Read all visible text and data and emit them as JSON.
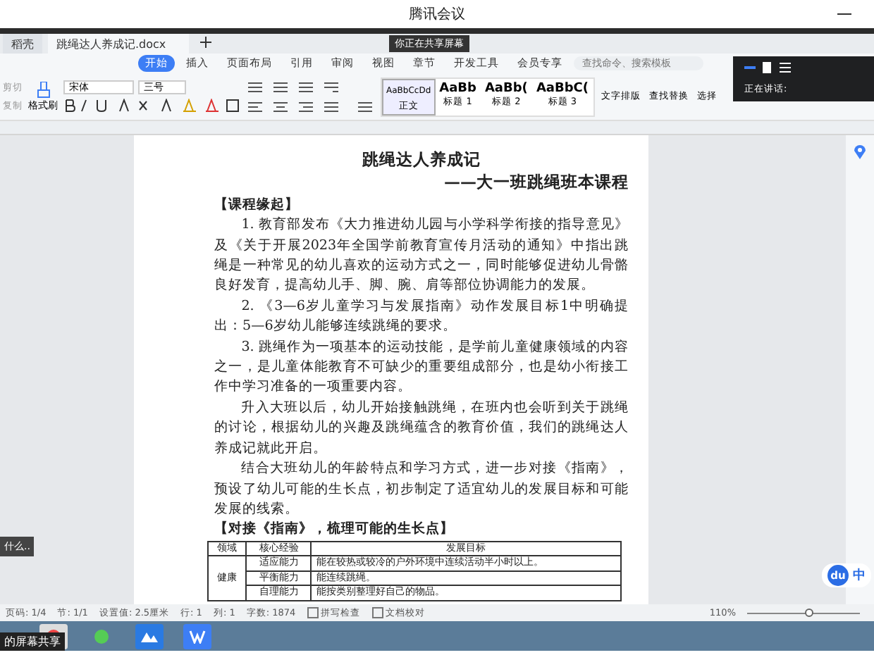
{
  "window": {
    "title": "腾讯会议"
  },
  "share_badge": "你正在共享屏幕",
  "tabs": [
    {
      "label": "稻壳",
      "selected": false
    },
    {
      "label": "跳绳达人养成记.docx",
      "selected": true
    }
  ],
  "menu": [
    {
      "label": "开始",
      "selected": true
    },
    {
      "label": "插入",
      "selected": false
    },
    {
      "label": "页面布局",
      "selected": false
    },
    {
      "label": "引用",
      "selected": false
    },
    {
      "label": "审阅",
      "selected": false
    },
    {
      "label": "视图",
      "selected": false
    },
    {
      "label": "章节",
      "selected": false
    },
    {
      "label": "开发工具",
      "selected": false
    },
    {
      "label": "会员专享",
      "selected": false
    }
  ],
  "search": {
    "placeholder": "查找命令、搜索模板"
  },
  "toolbar": {
    "clip": [
      "剪切",
      "复制"
    ],
    "format_painter": "格式刷",
    "font": "宋体",
    "size": "三号",
    "styles": [
      {
        "preview": "AaBbCcDd",
        "name": "正文",
        "selected": true
      },
      {
        "preview": "AaBb",
        "name": "标题 1",
        "selected": false
      },
      {
        "preview": "AaBb(",
        "name": "标题 2",
        "selected": false
      },
      {
        "preview": "AaBbC(",
        "name": "标题 3",
        "selected": false
      }
    ],
    "tools": [
      "文字排版",
      "查找替换",
      "选择"
    ]
  },
  "speaking_panel": {
    "label": "正在讲话:"
  },
  "document": {
    "title": "跳绳达人养成记",
    "subtitle": "——大一班跳绳班本课程",
    "blocks": [
      {
        "kind": "heading",
        "text": "【课程缘起】"
      },
      {
        "kind": "para",
        "text": "1. 教育部发布《大力推进幼儿园与小学科学衔接的指导意见》及《关于开展2023年全国学前教育宣传月活动的通知》中指出跳绳是一种常见的幼儿喜欢的运动方式之一，同时能够促进幼儿骨骼良好发育，提高幼儿手、脚、腕、肩等部位协调能力的发展。"
      },
      {
        "kind": "para",
        "text": "2. 《3—6岁儿童学习与发展指南》动作发展目标1中明确提出：5—6岁幼儿能够连续跳绳的要求。"
      },
      {
        "kind": "para",
        "text": "3. 跳绳作为一项基本的运动技能，是学前儿童健康领域的内容之一，是儿童体能教育不可缺少的重要组成部分，也是幼小衔接工作中学习准备的一项重要内容。"
      },
      {
        "kind": "para",
        "text": "升入大班以后，幼儿开始接触跳绳，在班内也会听到关于跳绳的讨论，根据幼儿的兴趣及跳绳蕴含的教育价值，我们的跳绳达人养成记就此开启。"
      },
      {
        "kind": "para",
        "text": "结合大班幼儿的年龄特点和学习方式，进一步对接《指南》，预设了幼儿可能的生长点，初步制定了适宜幼儿的发展目标和可能发展的线索。"
      },
      {
        "kind": "heading",
        "text": "【对接《指南》，梳理可能的生长点】"
      }
    ],
    "table": {
      "columns": [
        "领域",
        "核心经验",
        "发展目标"
      ],
      "rows": [
        {
          "domain": "健康",
          "items": [
            {
              "skill": "适应能力",
              "goal": "能在较热或较冷的户外环境中连续活动半小时以上。"
            },
            {
              "skill": "平衡能力",
              "goal": "能连续跳绳。"
            },
            {
              "skill": "自理能力",
              "goal": "能按类别整理好自己的物品。"
            }
          ]
        }
      ]
    }
  },
  "side_popup": "什么..",
  "status_bar": {
    "items": [
      "页码: 1/4",
      "节: 1/1",
      "设置值: 2.5厘米",
      "行: 1",
      "列: 1",
      "字数: 1874"
    ],
    "checks": [
      "拼写检查",
      "文档校对"
    ],
    "zoom": "110%",
    "zoom_slider": {
      "level": 0.55
    }
  },
  "ime": {
    "logo": "du",
    "mode": "中"
  },
  "taskbar": {
    "tooltip": "的屏幕共享"
  }
}
